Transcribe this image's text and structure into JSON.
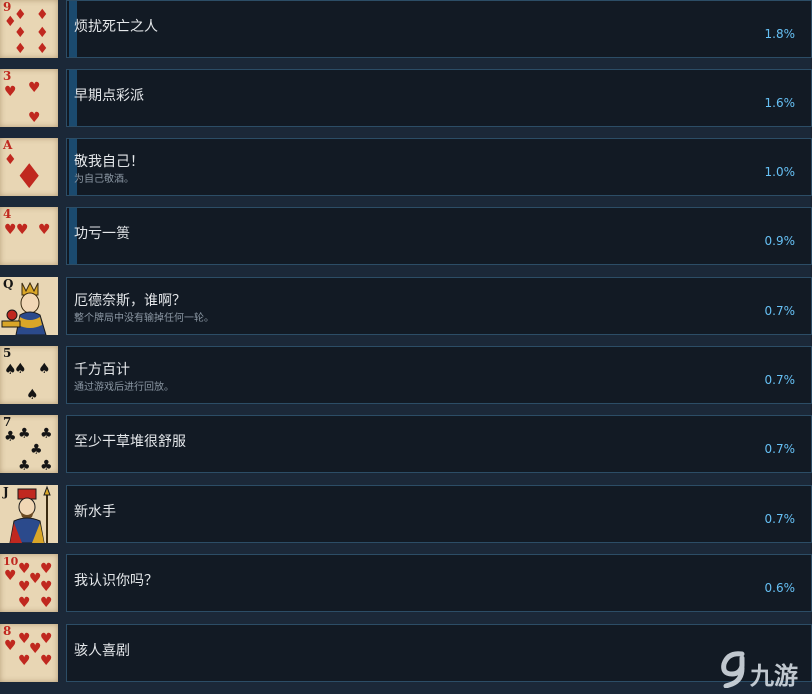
{
  "colors": {
    "background": "#1b2838",
    "panel": "#121a24",
    "panel_border": "#2c4d66",
    "progress": "#1b4a6e",
    "name_text": "#e4e7ea",
    "desc_text": "#8b97a3",
    "percent_text": "#66c0f4",
    "card_bg": "#e8d6b4",
    "suit_red": "#c0281f",
    "suit_black": "#151515"
  },
  "achievements": [
    {
      "card": "9",
      "suit": "diamond",
      "name": "烦扰死亡之人",
      "desc": "",
      "percent": "1.8%",
      "progress": 1.8
    },
    {
      "card": "3",
      "suit": "heart",
      "name": "早期点彩派",
      "desc": "",
      "percent": "1.6%",
      "progress": 1.6
    },
    {
      "card": "A",
      "suit": "diamond",
      "name": "敬我自己！",
      "desc": "为自己敬酒。",
      "percent": "1.0%",
      "progress": 1.0
    },
    {
      "card": "4",
      "suit": "heart",
      "name": "功亏一篑",
      "desc": "",
      "percent": "0.9%",
      "progress": 0.9
    },
    {
      "card": "Q",
      "suit": "face",
      "name": "厄德奈斯，谁啊？",
      "desc": "整个牌局中没有输掉任何一轮。",
      "percent": "0.7%",
      "progress": 0.7
    },
    {
      "card": "5",
      "suit": "spade",
      "name": "千方百计",
      "desc": "通过游戏后进行回放。",
      "percent": "0.7%",
      "progress": 0.7
    },
    {
      "card": "7",
      "suit": "club",
      "name": "至少干草堆很舒服",
      "desc": "",
      "percent": "0.7%",
      "progress": 0.7
    },
    {
      "card": "J",
      "suit": "face",
      "name": "新水手",
      "desc": "",
      "percent": "0.7%",
      "progress": 0.7
    },
    {
      "card": "10",
      "suit": "heart",
      "name": "我认识你吗？",
      "desc": "",
      "percent": "0.6%",
      "progress": 0.6
    },
    {
      "card": "8",
      "suit": "heart",
      "name": "骇人喜剧",
      "desc": "",
      "percent": "",
      "progress": 0.6
    }
  ],
  "watermark": {
    "text": "九游",
    "icon": "jiuyou-logo-icon"
  }
}
